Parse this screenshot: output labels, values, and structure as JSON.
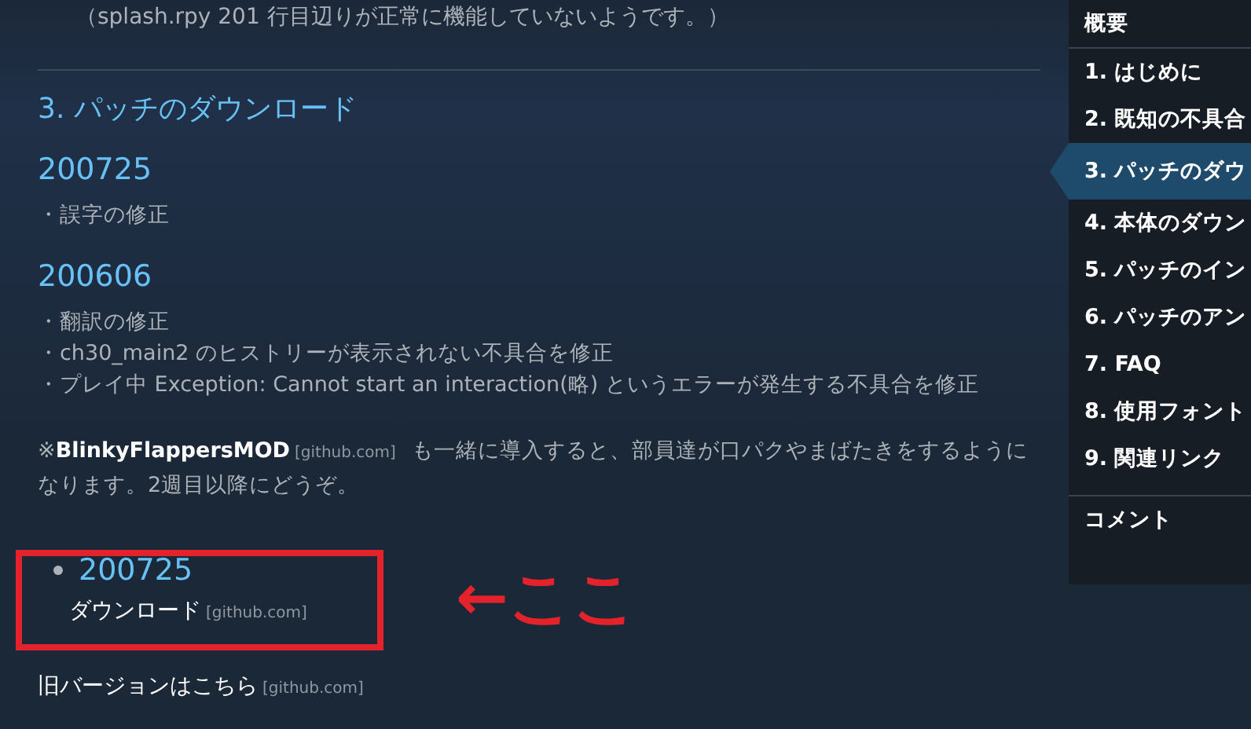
{
  "intro_note": "（splash.rpy 201 行目辺りが正常に機能していないようです。）",
  "section": {
    "heading": "3. パッチのダウンロード",
    "versions": [
      {
        "version": "200725",
        "items": [
          "・誤字の修正"
        ]
      },
      {
        "version": "200606",
        "items": [
          "・翻訳の修正",
          "・ch30_main2 のヒストリーが表示されない不具合を修正",
          "・プレイ中 Exception: Cannot start an interaction(略) というエラーが発生する不具合を修正"
        ]
      }
    ],
    "note": {
      "prefix": "※",
      "mod_name": "BlinkyFlappersMOD",
      "domain": "[github.com]",
      "text": "も一緒に導入すると、部員達が口パクやまばたきをするようになります。2週目以降にどうぞ。"
    },
    "download": {
      "version": "200725",
      "link": "ダウンロード",
      "domain": "[github.com]"
    },
    "old_versions": {
      "link": "旧バージョンはこちら",
      "domain": "[github.com]"
    }
  },
  "annotation": {
    "text": "←ここ"
  },
  "sidebar": {
    "items": [
      {
        "label": "概要",
        "kind": "top",
        "selected": false
      },
      {
        "label": "1. はじめに",
        "kind": "section",
        "selected": false
      },
      {
        "label": "2. 既知の不具合",
        "kind": "section",
        "selected": false
      },
      {
        "label": "3. パッチのダウ",
        "kind": "section",
        "selected": true
      },
      {
        "label": "4. 本体のダウン",
        "kind": "section",
        "selected": false
      },
      {
        "label": "5. パッチのイン",
        "kind": "section",
        "selected": false
      },
      {
        "label": "6. パッチのアン",
        "kind": "section",
        "selected": false
      },
      {
        "label": "7. FAQ",
        "kind": "section",
        "selected": false
      },
      {
        "label": "8. 使用フォント",
        "kind": "section",
        "selected": false
      },
      {
        "label": "9. 関連リンク",
        "kind": "section",
        "selected": false
      },
      {
        "label": "コメント",
        "kind": "comments",
        "selected": false
      }
    ]
  }
}
